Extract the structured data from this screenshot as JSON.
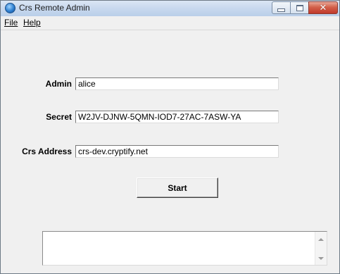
{
  "window": {
    "title": "Crs Remote Admin"
  },
  "menu": {
    "file": "File",
    "help": "Help"
  },
  "form": {
    "admin_label": "Admin",
    "admin_value": "alice",
    "secret_label": "Secret",
    "secret_value": "W2JV-DJNW-5QMN-IOD7-27AC-7ASW-YA",
    "address_label": "Crs Address",
    "address_value": "crs-dev.cryptify.net",
    "start_label": "Start"
  },
  "output": {
    "value": ""
  },
  "colors": {
    "window_bg": "#f0f0f0",
    "close_button": "#c0392b",
    "titlebar": "#c8d8ee"
  }
}
